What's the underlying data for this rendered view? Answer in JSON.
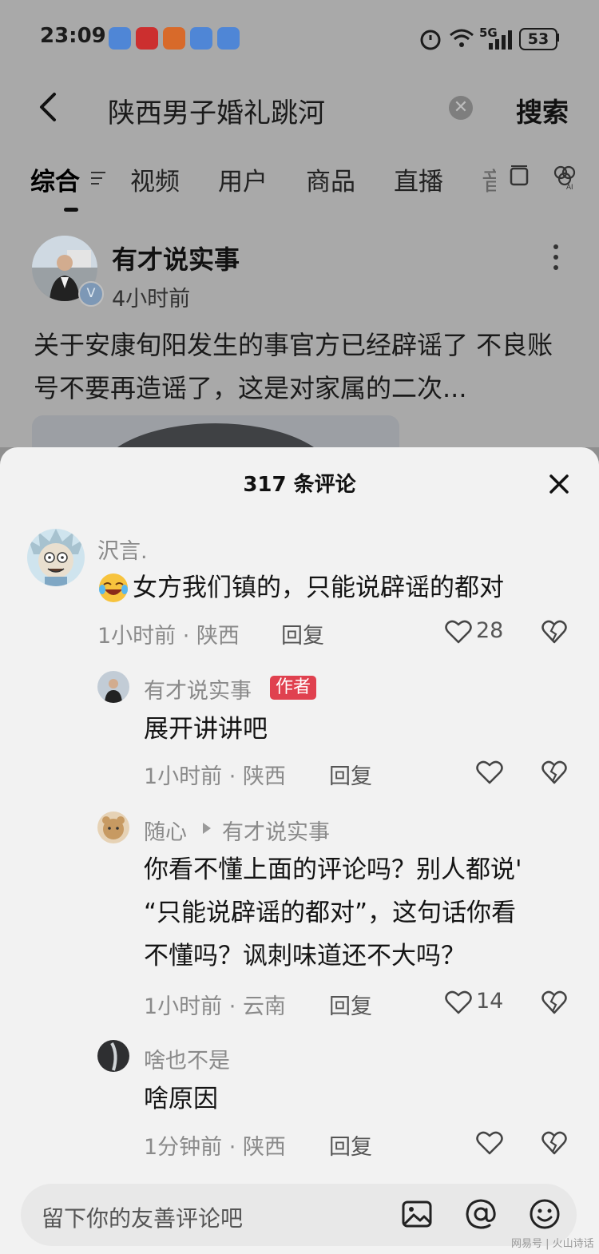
{
  "status_bar": {
    "time": "23:09",
    "network": "5G",
    "battery": "53"
  },
  "search": {
    "query": "陕西男子婚礼跳河",
    "button": "搜索"
  },
  "tabs": [
    {
      "label": "综合"
    },
    {
      "label": "视频"
    },
    {
      "label": "用户"
    },
    {
      "label": "商品"
    },
    {
      "label": "直播"
    },
    {
      "label": "音"
    }
  ],
  "post": {
    "author": "有才说实事",
    "time": "4小时前",
    "text": "关于安康旬阳发生的事官方已经辟谣了 不良账号不要再造谣了，这是对家属的二次..."
  },
  "comments_panel": {
    "title": "317 条评论",
    "comments": [
      {
        "name": "沢言.",
        "text": "女方我们镇的，只能说辟谣的都对",
        "time": "1小时前",
        "location": "陕西",
        "reply_label": "回复",
        "likes": "28"
      },
      {
        "name": "有才说实事",
        "tag": "作者",
        "text": "展开讲讲吧",
        "time": "1小时前",
        "location": "陕西",
        "reply_label": "回复"
      },
      {
        "name": "随心",
        "reply_to": "有才说实事",
        "text_lines": [
          "你看不懂上面的评论吗？别人都说'",
          "“只能说辟谣的都对”，这句话你看",
          "不懂吗？讽刺味道还不大吗？"
        ],
        "time": "1小时前",
        "location": "云南",
        "reply_label": "回复",
        "likes": "14"
      },
      {
        "name": "啥也不是",
        "text": "啥原因",
        "time": "1分钟前",
        "location": "陕西",
        "reply_label": "回复"
      }
    ]
  },
  "bottom_bar": {
    "placeholder": "留下你的友善评论吧"
  },
  "watermark": "网易号 | 火山诗话"
}
